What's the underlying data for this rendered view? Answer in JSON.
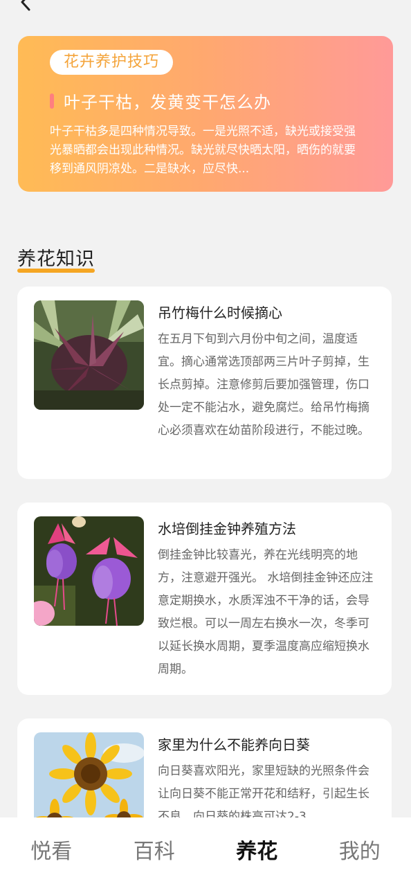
{
  "tip": {
    "badge": "花卉养护技巧",
    "title": "叶子干枯，发黄变干怎么办",
    "body": "叶子干枯多是四种情况导致。一是光照不适，缺光或接受强光暴晒都会出现此种情况。缺光就尽快晒太阳，晒伤的就要移到通风阴凉处。二是缺水，应尽快..."
  },
  "section": {
    "title": "养花知识"
  },
  "articles": [
    {
      "title": "吊竹梅什么时候摘心",
      "body": "在五月下旬到六月份中旬之间，温度适宜。摘心通常选顶部两三片叶子剪掉，生长点剪掉。注意修剪后要加强管理，伤口处一定不能沾水，避免腐烂。给吊竹梅摘心必须喜欢在幼苗阶段进行，不能过晚。"
    },
    {
      "title": "水培倒挂金钟养殖方法",
      "body": "倒挂金钟比较喜光，养在光线明亮的地方，注意避开强光。 水培倒挂金钟还应注意定期换水，水质浑浊不干净的话，会导致烂根。可以一周左右换水一次，冬季可以延长换水周期，夏季温度高应缩短换水周期。"
    },
    {
      "title": "家里为什么不能养向日葵",
      "body": "向日葵喜欢阳光，家里短缺的光照条件会让向日葵不能正常开花和结籽，引起生长不良。向日葵的株高可达2-3"
    }
  ],
  "nav": {
    "items": [
      "悦看",
      "百科",
      "养花",
      "我的"
    ],
    "active": "养花"
  },
  "colors": {
    "accent": "#f5a623",
    "banner_start": "#ffbb55",
    "banner_end": "#ff9a98"
  }
}
